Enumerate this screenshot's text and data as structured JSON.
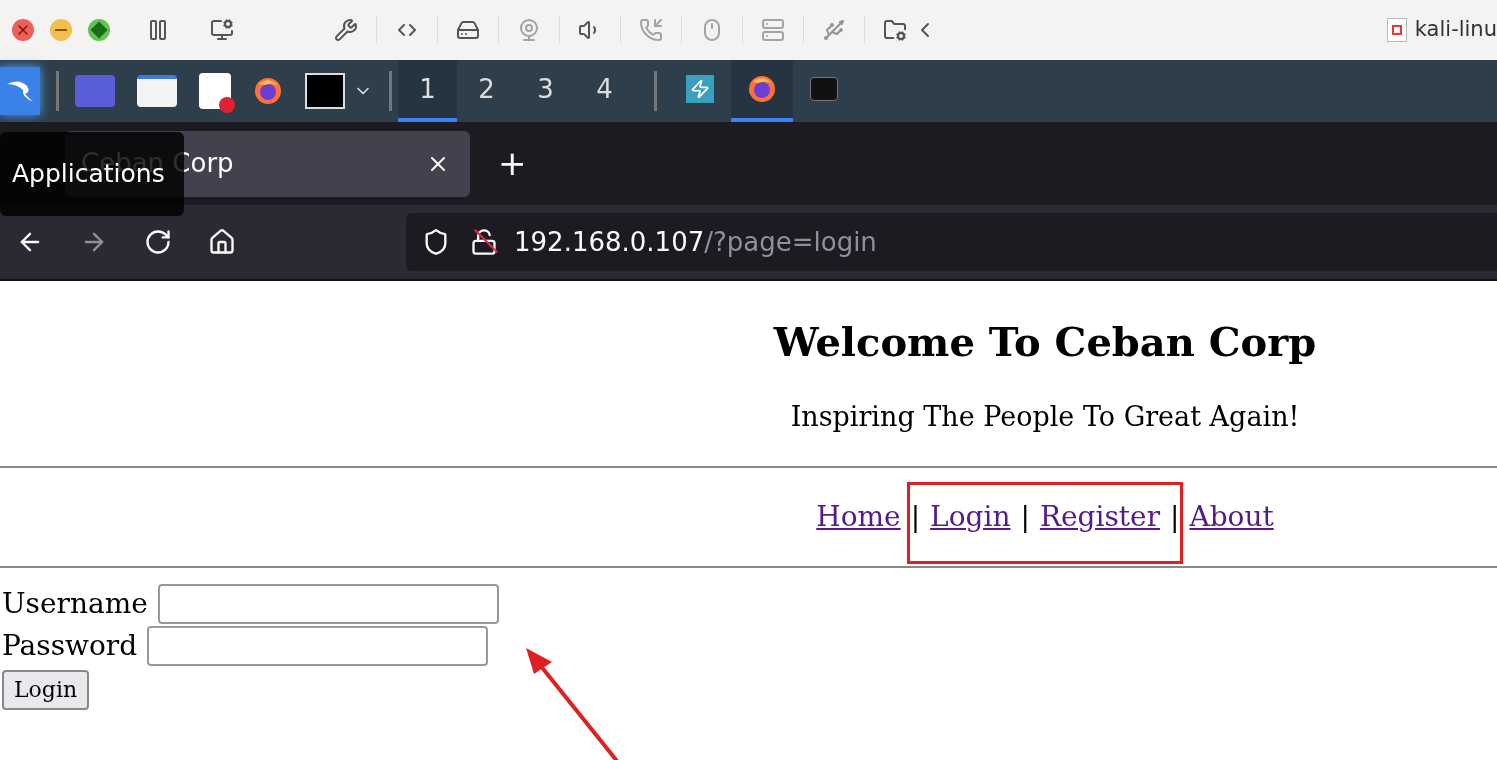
{
  "vm_toolbar": {
    "title": "kali-linu"
  },
  "taskbar": {
    "workspaces": [
      {
        "label": "1",
        "selected": true
      },
      {
        "label": "2",
        "selected": false
      },
      {
        "label": "3",
        "selected": false
      },
      {
        "label": "4",
        "selected": false
      }
    ],
    "running_apps": [
      {
        "kind": "power",
        "selected": false
      },
      {
        "kind": "browser",
        "selected": true
      },
      {
        "kind": "terminal",
        "selected": false
      }
    ]
  },
  "tooltip": "Applications",
  "browser": {
    "tabs": [
      {
        "title": "Ceban Corp",
        "selected": true
      }
    ],
    "new_tab": "+",
    "url": {
      "host": "192.168.0.107",
      "path": "/?page=login"
    }
  },
  "page": {
    "heading": "Welcome To Ceban Corp",
    "tagline": "Inspiring The People To Great Again!",
    "nav": [
      {
        "kind": "link",
        "text": "Home"
      },
      {
        "kind": "separator",
        "text": "|"
      },
      {
        "kind": "link",
        "text": "Login"
      },
      {
        "kind": "separator",
        "text": "|"
      },
      {
        "kind": "link",
        "text": "Register"
      },
      {
        "kind": "separator",
        "text": "|"
      },
      {
        "kind": "link",
        "text": "About"
      }
    ],
    "fields": [
      {
        "label": "Username"
      },
      {
        "label": "Password"
      }
    ],
    "submit": "Login"
  }
}
